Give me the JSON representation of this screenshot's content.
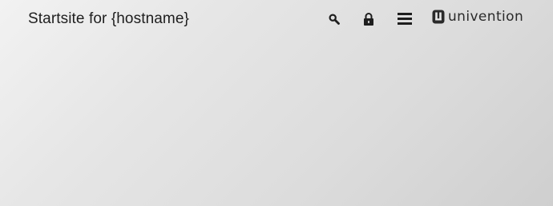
{
  "header": {
    "title": "Startsite for {hostname}",
    "icons": {
      "search": "search-icon",
      "lock": "lock-icon",
      "menu": "menu-icon"
    },
    "logo": {
      "text": "univention",
      "icon": "univention-logo-icon"
    }
  },
  "colors": {
    "text": "#1e1e1e",
    "icon": "#1e1e1e",
    "background_light": "#f2f2f2",
    "background_dark": "#cfcfcf"
  }
}
